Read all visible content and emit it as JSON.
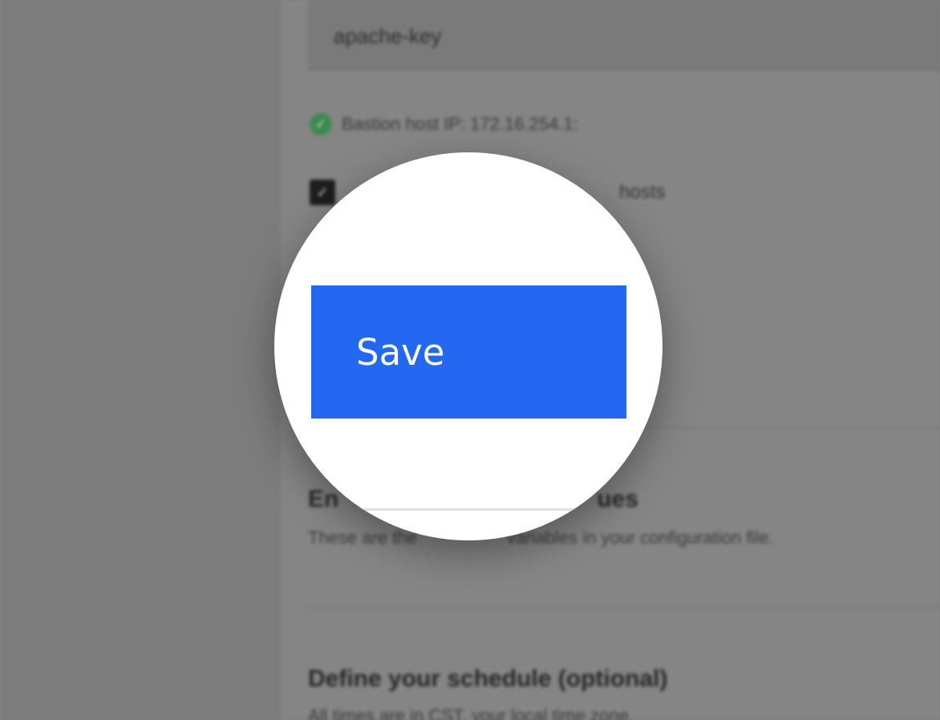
{
  "background": {
    "key_field": {
      "value": "apache-key"
    },
    "bastion": {
      "text": "Bastion host IP: 172.16.254.1:",
      "status_color": "#3d8a4f"
    },
    "checkbox": {
      "checked": true,
      "label_fragment": "hosts"
    },
    "env_section": {
      "title_start": "En",
      "title_end": "ues",
      "description": "These are the ",
      "description_end": " variables in your configuration file."
    },
    "schedule_section": {
      "title": "Define your schedule (optional)",
      "description": "All times are in CST, your local time zone."
    }
  },
  "magnifier": {
    "save_label": "Save",
    "button_color": "#2468f2"
  }
}
